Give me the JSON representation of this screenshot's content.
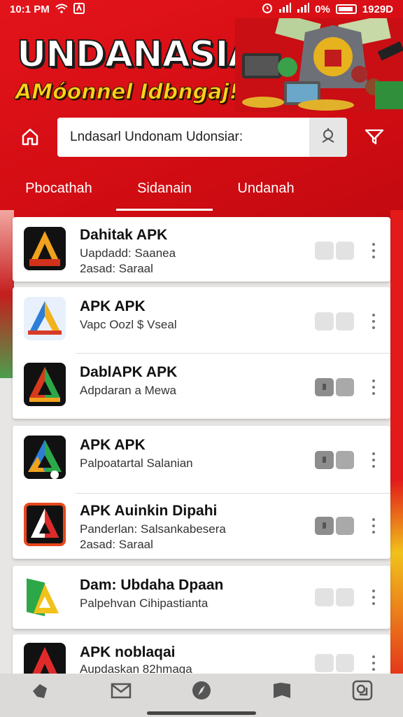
{
  "status_bar": {
    "time": "10:1 PM",
    "battery_percent": "0%",
    "right_text": "1929D"
  },
  "banner": {
    "title": "UNDANASIA",
    "subtitle": "AMóonnel Idbngaj!!"
  },
  "search": {
    "value": "Lndasarl Undonam Udonsiar:"
  },
  "tabs": [
    {
      "label": "Pbocathah"
    },
    {
      "label": "Sidanain"
    },
    {
      "label": "Undanah"
    }
  ],
  "selected_tab": "Sidanain",
  "apps": [
    {
      "name": "Dahitak APK",
      "line1": "Uapdadd: Saanea",
      "line2": "2asad: Saraal",
      "toggle": "light"
    },
    {
      "name": "APK APK",
      "line1": "Vapc Oozl $ Vseal",
      "line2": "",
      "toggle": "light"
    },
    {
      "name": "DablAPK APK",
      "line1": "Adpdaran a Mewa",
      "line2": "",
      "toggle": "dark"
    },
    {
      "name": "APK APK",
      "line1": "Palpoatartal Salanian",
      "line2": "",
      "toggle": "dark"
    },
    {
      "name": "APK Auinkin Dipahi",
      "line1": "Panderlan: Salsankabesera",
      "line2": "2asad: Saraal",
      "toggle": "dark"
    },
    {
      "name": "Dam: Ubdaha Dpaan",
      "line1": "Palpehvan Cihipastianta",
      "line2": "",
      "toggle": "light"
    },
    {
      "name": "APK noblaqai",
      "line1": "Aupdaskan 82hmaga",
      "line2": "",
      "toggle": "light"
    }
  ],
  "colors": {
    "brand_red": "#e3141b",
    "banner_yellow": "#ffd21a"
  },
  "icons": {
    "home": "home-icon",
    "search": "search-icon",
    "filter": "filter-icon",
    "more": "kebab-menu-icon",
    "nav": [
      "brush-icon",
      "mail-icon",
      "compass-icon",
      "bookmark-icon",
      "apps-icon"
    ]
  }
}
